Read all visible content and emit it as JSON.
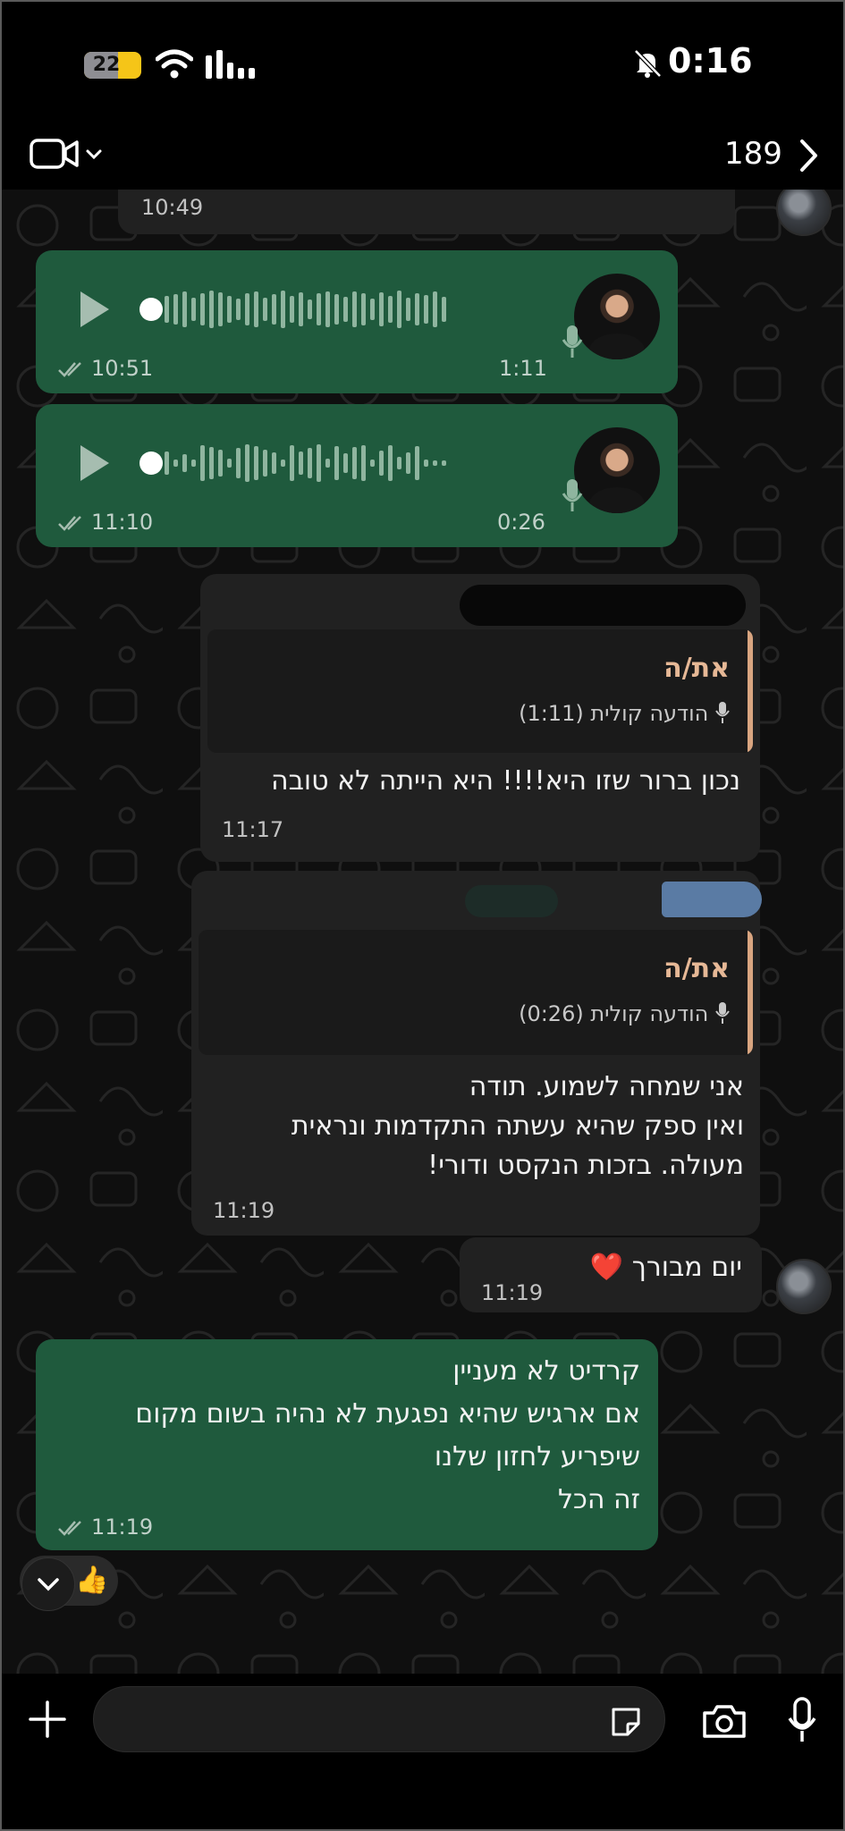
{
  "status_bar": {
    "battery": "22",
    "time": "0:16"
  },
  "header": {
    "unread_count": "189"
  },
  "messages": {
    "top_partial_time": "10:49",
    "voice1": {
      "duration": "1:11",
      "time": "10:51"
    },
    "voice2": {
      "duration": "0:26",
      "time": "11:10"
    },
    "reply1": {
      "quote_author": "את/ה",
      "quote_text": "הודעה קולית (1:11)",
      "text": "נכון ברור שזו היא!!!! היא הייתה לא טובה",
      "time": "11:17"
    },
    "reply2": {
      "quote_author": "את/ה",
      "quote_text": "הודעה קולית (0:26)",
      "line1": "אני שמחה לשמוע. תודה",
      "line2": "ואין ספק שהיא עשתה התקדמות ונראית",
      "line3": "מעולה. בזכות הנקסט ודורי!",
      "time": "11:19"
    },
    "greeting": {
      "text": "יום מבורך",
      "emoji": "❤️",
      "time": "11:19"
    },
    "last": {
      "line1": "קרדיט לא מעניין",
      "line2": "אם ארגיש שהיא נפגעת לא נהיה בשום מקום",
      "line3": "שיפריע לחזון שלנו",
      "line4": "זה הכל",
      "time": "11:19",
      "reaction": "👍"
    }
  },
  "colors": {
    "outgoing": "#1f5a3d",
    "incoming": "#212121",
    "quote_bar": "#d9a580",
    "quote_author": "#e6b896"
  },
  "icons": [
    "video-icon",
    "chevron-down-icon",
    "chevron-right-icon",
    "wifi-icon",
    "signal-icon",
    "bell-off-icon",
    "play-icon",
    "mic-icon",
    "double-check-icon",
    "plus-icon",
    "sticker-icon",
    "camera-icon"
  ]
}
